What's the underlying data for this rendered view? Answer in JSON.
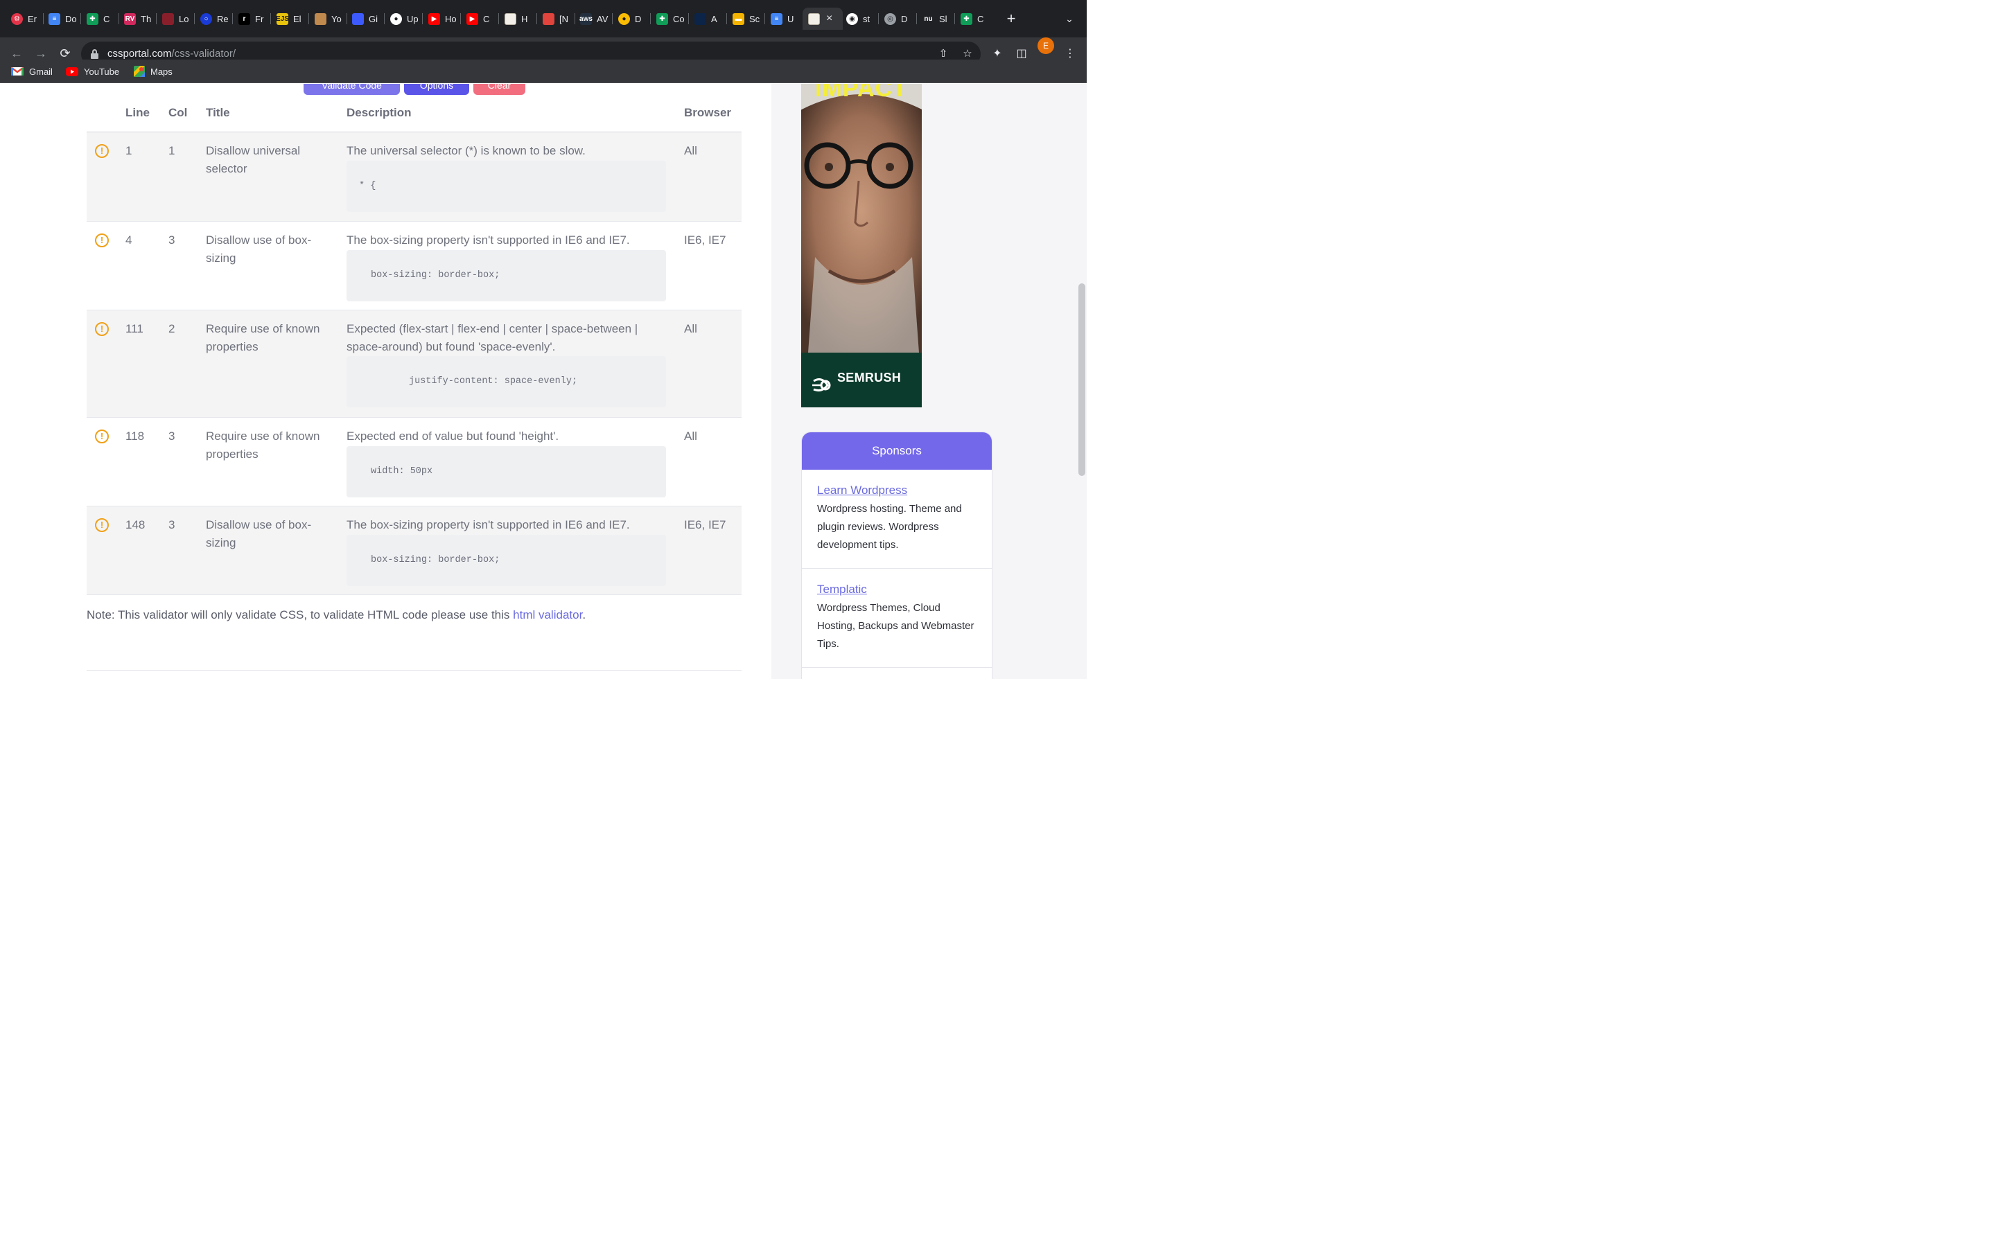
{
  "browser": {
    "tabs": [
      {
        "title": "Er",
        "icon_name": "tab-favicon-red-gear",
        "color": "#e3344a"
      },
      {
        "title": "Do",
        "icon_name": "tab-favicon-google-docs",
        "color": "#4285f4"
      },
      {
        "title": "C",
        "icon_name": "tab-favicon-google-sheets",
        "color": "#0f9d58"
      },
      {
        "title": "Th",
        "icon_name": "tab-favicon-rv",
        "color": "#d1295e"
      },
      {
        "title": "Lo",
        "icon_name": "tab-favicon-red-shape",
        "color": "#8a1f2c"
      },
      {
        "title": "Re",
        "icon_name": "tab-favicon-blue-ring",
        "color": "#1a3bd6"
      },
      {
        "title": "Fr",
        "icon_name": "tab-favicon-r-logo",
        "color": "#000000"
      },
      {
        "title": "El",
        "icon_name": "tab-favicon-ejs",
        "color": "#e8c30d"
      },
      {
        "title": "Yo",
        "icon_name": "tab-favicon-character",
        "color": "#c08a4e"
      },
      {
        "title": "Gi",
        "icon_name": "tab-favicon-cloud",
        "color": "#3d5afe"
      },
      {
        "title": "Up",
        "icon_name": "tab-favicon-github",
        "color": "#ffffff"
      },
      {
        "title": "Ho",
        "icon_name": "tab-favicon-youtube",
        "color": "#ff0000"
      },
      {
        "title": "C",
        "icon_name": "tab-favicon-youtube",
        "color": "#ff0000"
      },
      {
        "title": "H",
        "icon_name": "tab-favicon-cssportal",
        "color": "#f1efe7"
      },
      {
        "title": "[N",
        "icon_name": "tab-favicon-figure",
        "color": "#e0443c"
      },
      {
        "title": "AV",
        "icon_name": "tab-favicon-aws",
        "color": "#232f3e"
      },
      {
        "title": "D",
        "icon_name": "tab-favicon-chrome",
        "color": "#fbbc04"
      },
      {
        "title": "Co",
        "icon_name": "tab-favicon-google-sheets",
        "color": "#0f9d58"
      },
      {
        "title": "A",
        "icon_name": "tab-favicon-dark-blue",
        "color": "#0b2447"
      },
      {
        "title": "Sc",
        "icon_name": "tab-favicon-google-slides",
        "color": "#f4b400"
      },
      {
        "title": "U",
        "icon_name": "tab-favicon-google-docs",
        "color": "#4285f4"
      },
      {
        "title": "",
        "icon_name": "tab-favicon-cssportal",
        "color": "#f1efe7",
        "active": true
      },
      {
        "title": "st",
        "icon_name": "tab-favicon-circle-dark",
        "color": "#ffffff"
      },
      {
        "title": "D",
        "icon_name": "tab-favicon-globe",
        "color": "#9aa0a6"
      },
      {
        "title": "Sl",
        "icon_name": "tab-favicon-nu",
        "color": "#202124"
      },
      {
        "title": "C",
        "icon_name": "tab-favicon-google-sheets",
        "color": "#0f9d58"
      }
    ],
    "active_tab_close": "×",
    "new_tab": "+",
    "url_host": "cssportal.com",
    "url_path": "/css-validator/",
    "profile_initial": "E",
    "bookmarks": [
      {
        "label": "Gmail",
        "icon_name": "gmail-icon",
        "color": "#ea4335"
      },
      {
        "label": "YouTube",
        "icon_name": "youtube-icon",
        "color": "#ff0000"
      },
      {
        "label": "Maps",
        "icon_name": "maps-icon",
        "color": "#34a853"
      }
    ]
  },
  "buttons": {
    "validate": "Validate Code",
    "options": "Options",
    "clear": "Clear",
    "validate_color": "#7b74ea",
    "options_color": "#5b54e8",
    "clear_color": "#f26e7f"
  },
  "table": {
    "headers": {
      "line": "Line",
      "col": "Col",
      "title": "Title",
      "description": "Description",
      "browser": "Browser"
    },
    "rows": [
      {
        "line": "1",
        "col": "1",
        "title": "Disallow universal selector",
        "description": "The universal selector (*) is known to be slow.",
        "code": "* {",
        "browser": "All"
      },
      {
        "line": "4",
        "col": "3",
        "title": "Disallow use of box-sizing",
        "description": "The box-sizing property isn't supported in IE6 and IE7.",
        "code": "box-sizing: border-box;",
        "browser": "IE6, IE7"
      },
      {
        "line": "111",
        "col": "2",
        "title": "Require use of known properties",
        "description": "Expected (flex-start | flex-end | center | space-between | space-around) but found 'space-evenly'.",
        "code": "justify-content: space-evenly;",
        "browser": "All"
      },
      {
        "line": "118",
        "col": "3",
        "title": "Require use of known properties",
        "description": "Expected end of value but found 'height'.",
        "code": "width: 50px",
        "browser": "All"
      },
      {
        "line": "148",
        "col": "3",
        "title": "Disallow use of box-sizing",
        "description": "The box-sizing property isn't supported in IE6 and IE7.",
        "code": "box-sizing: border-box;",
        "browser": "IE6, IE7"
      }
    ],
    "warning_glyph": "!",
    "warning_color": "#f0a118"
  },
  "note": {
    "text": "Note: This validator will only validate CSS, to validate HTML code please use this ",
    "link": "html validator",
    "end": "."
  },
  "ad": {
    "headline": "IMPACT",
    "brand": "SEMRUSH",
    "headline_color": "#f4ee3a",
    "footer_color": "#0b3b2c"
  },
  "sponsors": {
    "title": "Sponsors",
    "header_color": "#7468ea",
    "items": [
      {
        "name": "Learn Wordpress",
        "desc": "Wordpress hosting. Theme and plugin reviews. Wordpress development tips."
      },
      {
        "name": "Templatic",
        "desc": "Wordpress Themes, Cloud Hosting, Backups and Webmaster Tips."
      }
    ]
  }
}
